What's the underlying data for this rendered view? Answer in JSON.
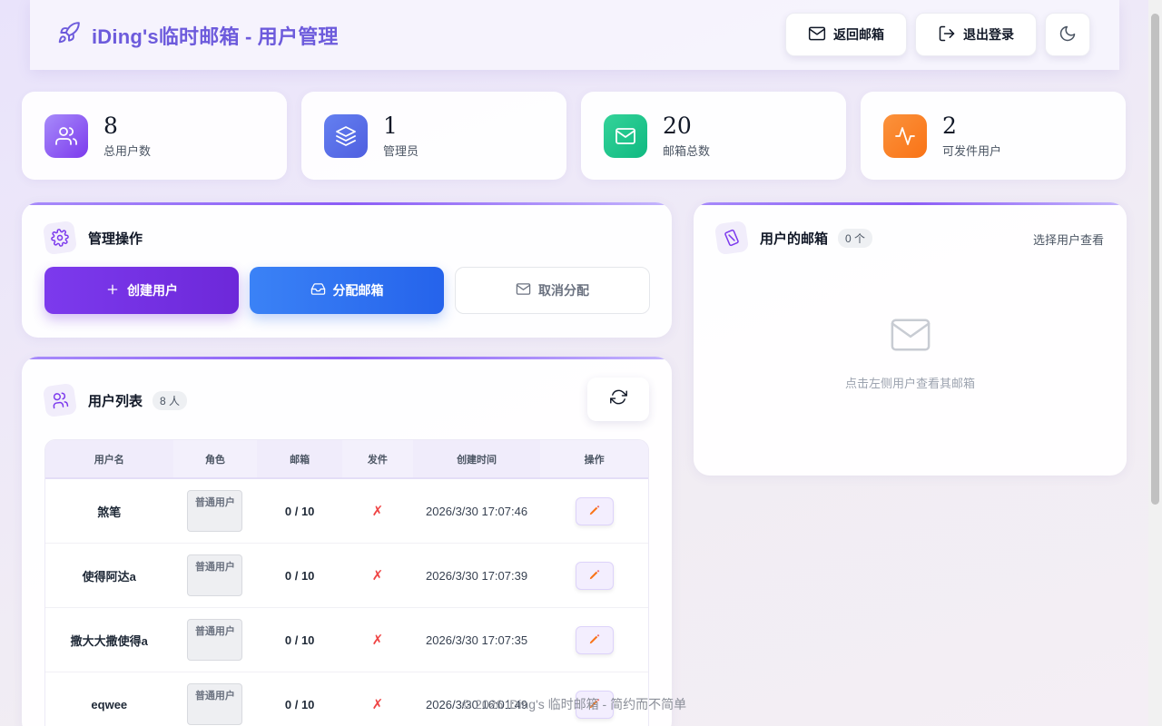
{
  "header": {
    "title": "iDing's临时邮箱 - 用户管理",
    "back_label": "返回邮箱",
    "logout_label": "退出登录"
  },
  "stats": [
    {
      "value": "8",
      "label": "总用户数",
      "icon": "users-icon",
      "color": "#8b5cf6"
    },
    {
      "value": "1",
      "label": "管理员",
      "icon": "layers-icon",
      "color": "#4f67e8"
    },
    {
      "value": "20",
      "label": "邮箱总数",
      "icon": "mail-icon",
      "color": "#22c08a"
    },
    {
      "value": "2",
      "label": "可发件用户",
      "icon": "activity-icon",
      "color": "#f97316"
    }
  ],
  "admin_ops": {
    "title": "管理操作",
    "create_label": "创建用户",
    "assign_label": "分配邮箱",
    "unassign_label": "取消分配"
  },
  "user_list": {
    "title": "用户列表",
    "count": "8 人",
    "columns": [
      "用户名",
      "角色",
      "邮箱",
      "发件",
      "创建时间",
      "操作"
    ],
    "rows": [
      {
        "name": "煞笔",
        "role": "普通用户",
        "mailbox": "0 / 10",
        "send": "✗",
        "created": "2026/3/30 17:07:46"
      },
      {
        "name": "使得阿达a",
        "role": "普通用户",
        "mailbox": "0 / 10",
        "send": "✗",
        "created": "2026/3/30 17:07:39"
      },
      {
        "name": "撒大大撒使得a",
        "role": "普通用户",
        "mailbox": "0 / 10",
        "send": "✗",
        "created": "2026/3/30 17:07:35"
      },
      {
        "name": "eqwee",
        "role": "普通用户",
        "mailbox": "0 / 10",
        "send": "✗",
        "created": "2026/3/30 16:01:49"
      }
    ]
  },
  "user_mailboxes": {
    "title": "用户的邮箱",
    "count": "0 个",
    "hint": "选择用户查看",
    "empty_text": "点击左侧用户查看其邮箱"
  },
  "footer": "© 2026 iDing's 临时邮箱 - 简约而不简单",
  "colors": {
    "accent": "#6d5bdc",
    "primary": "#7c3aed",
    "blue": "#2563eb",
    "danger": "#ef4444"
  }
}
